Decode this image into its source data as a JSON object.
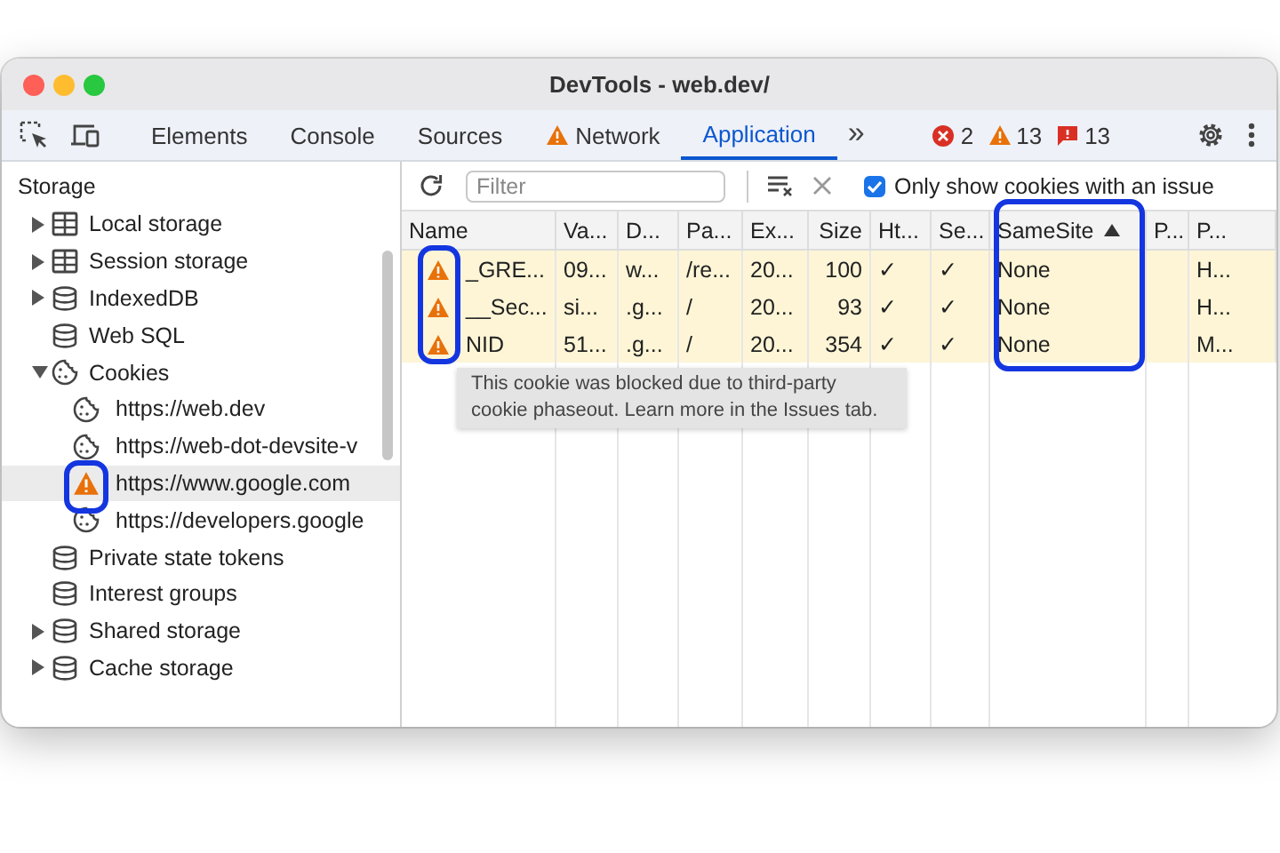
{
  "window": {
    "title": "DevTools - web.dev/"
  },
  "tabs": [
    {
      "label": "Elements",
      "selected": false,
      "warning": false
    },
    {
      "label": "Console",
      "selected": false,
      "warning": false
    },
    {
      "label": "Sources",
      "selected": false,
      "warning": false
    },
    {
      "label": "Network",
      "selected": false,
      "warning": true
    },
    {
      "label": "Application",
      "selected": true,
      "warning": false
    }
  ],
  "overflow": "»",
  "counts": {
    "errors": "2",
    "warnings": "13",
    "issues": "13"
  },
  "sidebar": {
    "heading": "Storage",
    "items": [
      {
        "label": "Local storage",
        "kind": "table",
        "expanded": false
      },
      {
        "label": "Session storage",
        "kind": "table",
        "expanded": false
      },
      {
        "label": "IndexedDB",
        "kind": "database",
        "expanded": false
      },
      {
        "label": "Web SQL",
        "kind": "database"
      },
      {
        "label": "Cookies",
        "kind": "cookie",
        "expanded": true,
        "children": [
          {
            "label": "https://web.dev",
            "kind": "cookie",
            "selected": false
          },
          {
            "label": "https://web-dot-devsite-v",
            "kind": "cookie",
            "selected": false
          },
          {
            "label": "https://www.google.com",
            "kind": "warning",
            "selected": true
          },
          {
            "label": "https://developers.google",
            "kind": "cookie",
            "selected": false
          }
        ]
      },
      {
        "label": "Private state tokens",
        "kind": "database"
      },
      {
        "label": "Interest groups",
        "kind": "database"
      },
      {
        "label": "Shared storage",
        "kind": "database",
        "expanded": false
      },
      {
        "label": "Cache storage",
        "kind": "database",
        "expanded": false
      }
    ]
  },
  "cookie_toolbar": {
    "filter": {
      "placeholder": "Filter"
    },
    "only_issues": {
      "label": "Only show cookies with an issue",
      "checked": true
    }
  },
  "table": {
    "columns": [
      {
        "label": "Name",
        "kind": "text",
        "sorted": false
      },
      {
        "label": "Va...",
        "kind": "text",
        "sorted": false
      },
      {
        "label": "D...",
        "kind": "text",
        "sorted": false
      },
      {
        "label": "Pa...",
        "kind": "text",
        "sorted": false
      },
      {
        "label": "Ex...",
        "kind": "text",
        "sorted": false
      },
      {
        "label": "Size",
        "kind": "number",
        "sorted": false
      },
      {
        "label": "Ht...",
        "kind": "text",
        "sorted": false
      },
      {
        "label": "Se...",
        "kind": "text",
        "sorted": false
      },
      {
        "label": "SameSite",
        "kind": "text",
        "sorted": true
      },
      {
        "label": "P...",
        "kind": "text",
        "sorted": false
      },
      {
        "label": "P...",
        "kind": "text",
        "sorted": false
      }
    ],
    "rows": [
      {
        "blocked": true,
        "cells": [
          "_GRE...",
          "09...",
          "w...",
          "/re...",
          "20...",
          "100",
          "✓",
          "✓",
          "None",
          null,
          "H..."
        ]
      },
      {
        "blocked": true,
        "cells": [
          "__Sec...",
          "si...",
          ".g...",
          "/",
          "20...",
          "93",
          "✓",
          "✓",
          "None",
          null,
          "H..."
        ]
      },
      {
        "blocked": true,
        "cells": [
          "NID",
          "51...",
          ".g...",
          "/",
          "20...",
          "354",
          "✓",
          "✓",
          "None",
          null,
          "M..."
        ]
      }
    ]
  },
  "tooltip": "This cookie was blocked due to third-party cookie phaseout. Learn more in the Issues tab."
}
